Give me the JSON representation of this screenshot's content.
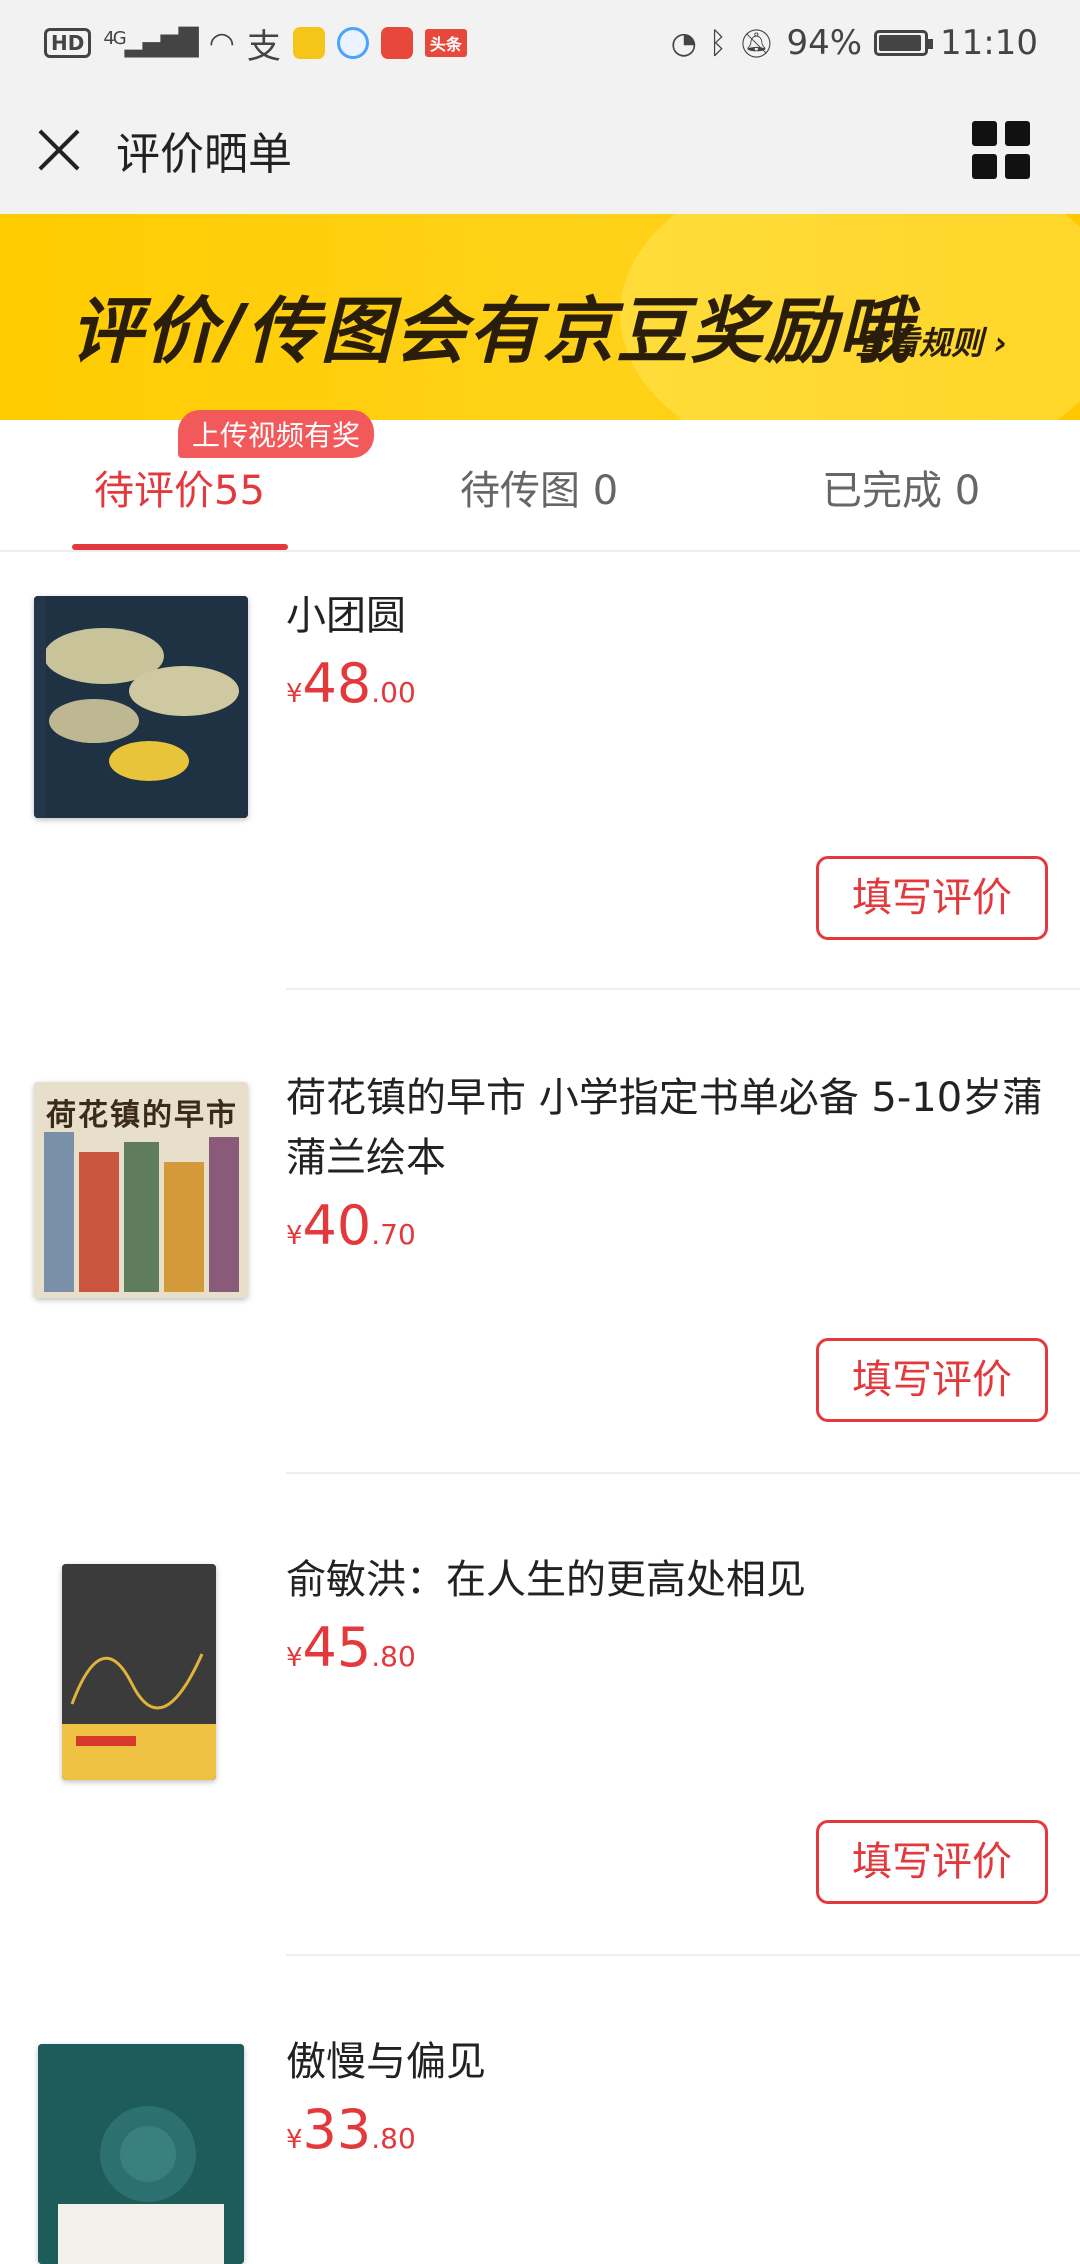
{
  "status_bar": {
    "left": {
      "hd": "HD",
      "network": "4G",
      "app_pay_glyph": "支",
      "toutiao": "头条"
    },
    "right": {
      "battery": "94%",
      "time": "11:10"
    }
  },
  "nav": {
    "title": "评价晒单",
    "close_icon": "close-icon",
    "menu_icon": "grid-menu-icon"
  },
  "banner": {
    "main_text": "评价/传图会有京豆奖励哦",
    "rules_link": "查看规则 ›"
  },
  "tabs": {
    "badge": "上传视频有奖",
    "items": [
      {
        "label": "待评价55",
        "active": true
      },
      {
        "label": "待传图 0",
        "active": false
      },
      {
        "label": "已完成 0",
        "active": false
      }
    ]
  },
  "products": [
    {
      "title": "小团圆",
      "price_symbol": "¥",
      "price_int": "48",
      "price_dec": ".00",
      "button": "填写评价"
    },
    {
      "title": "荷花镇的早市 小学指定书单必备 5-10岁蒲蒲兰绘本",
      "price_symbol": "¥",
      "price_int": "40",
      "price_dec": ".70",
      "button": "填写评价",
      "cover_text": "荷花镇的早市"
    },
    {
      "title": "俞敏洪：在人生的更高处相见",
      "price_symbol": "¥",
      "price_int": "45",
      "price_dec": ".80",
      "button": "填写评价"
    },
    {
      "title": "傲慢与偏见",
      "price_symbol": "¥",
      "price_int": "33",
      "price_dec": ".80"
    }
  ],
  "colors": {
    "accent": "#e4393c",
    "banner": "#ffcc00",
    "bar_bg": "#f2f2f2"
  }
}
